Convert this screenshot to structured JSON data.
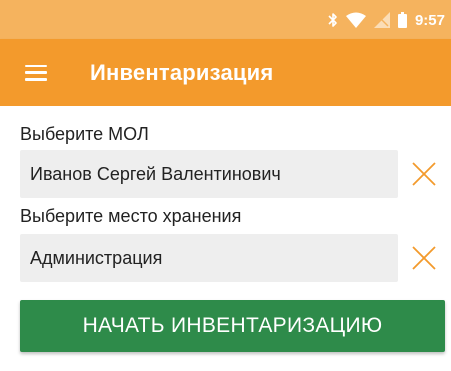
{
  "status_bar": {
    "time": "9:57",
    "icons": [
      "bluetooth-icon",
      "wifi-icon",
      "no-signal-icon",
      "battery-icon"
    ]
  },
  "app_bar": {
    "title": "Инвентаризация",
    "menu_icon": "menu-icon"
  },
  "form": {
    "mol": {
      "label": "Выберите МОЛ",
      "value": "Иванов Сергей Валентинович",
      "clear_icon": "close-icon"
    },
    "storage": {
      "label": "Выберите место хранения",
      "value": "Администрация",
      "clear_icon": "close-icon"
    },
    "start_button_label": "НАЧАТЬ ИНВЕНТАРИЗАЦИЮ"
  },
  "colors": {
    "status_bar": "#f5b35e",
    "app_bar": "#f39a2c",
    "clear_icon": "#f39a2c",
    "primary_button": "#2e8b4a",
    "field_background": "#eeeeee"
  }
}
